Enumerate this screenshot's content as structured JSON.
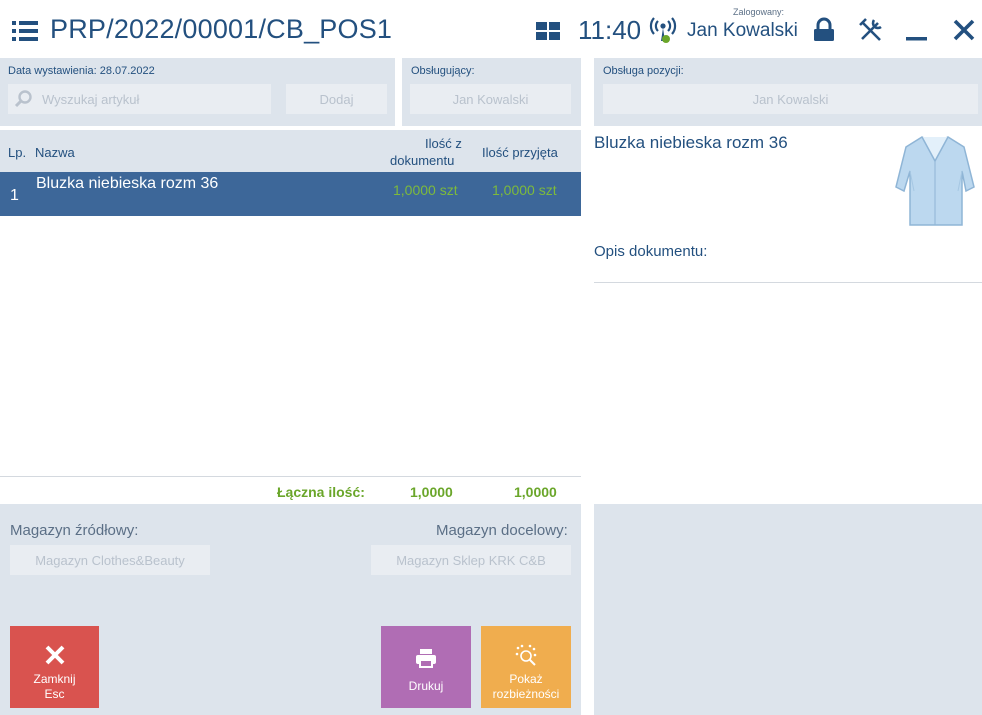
{
  "header": {
    "title": "PRP/2022/00001/CB_POS1",
    "time": "11:40",
    "logged_label": "Zalogowany:",
    "user": "Jan Kowalski"
  },
  "top": {
    "date_label": "Data wystawienia: 28.07.2022",
    "search_placeholder": "Wyszukaj artykuł",
    "add_label": "Dodaj",
    "operator_label": "Obsługujący:",
    "operator_value": "Jan Kowalski",
    "item_handler_label": "Obsługa pozycji:",
    "item_handler_value": "Jan Kowalski"
  },
  "table": {
    "col_lp": "Lp.",
    "col_name": "Nazwa",
    "col_doc_qty_1": "Ilość z",
    "col_doc_qty_2": "dokumentu",
    "col_recv_qty": "Ilość przyjęta",
    "rows": [
      {
        "lp": "1",
        "name": "Bluzka niebieska rozm 36",
        "doc_qty": "1,0000 szt",
        "recv_qty": "1,0000 szt"
      }
    ],
    "total_label": "Łączna ilość:",
    "total_doc": "1,0000",
    "total_recv": "1,0000"
  },
  "detail": {
    "product_name": "Bluzka niebieska rozm 36",
    "opis_label": "Opis dokumentu:"
  },
  "warehouses": {
    "source_label": "Magazyn źródłowy:",
    "source_value": "Magazyn Clothes&Beauty",
    "target_label": "Magazyn docelowy:",
    "target_value": "Magazyn Sklep KRK C&B"
  },
  "buttons": {
    "close_1": "Zamknij",
    "close_2": "Esc",
    "print": "Drukuj",
    "diff_1": "Pokaż",
    "diff_2": "rozbieżności"
  },
  "colors": {
    "accent": "#23507f",
    "selected_row": "#3d6799",
    "close_btn": "#d9534f",
    "print_btn": "#b06db4",
    "diff_btn": "#f0ad4e",
    "qty_green": "#6aa62a"
  }
}
